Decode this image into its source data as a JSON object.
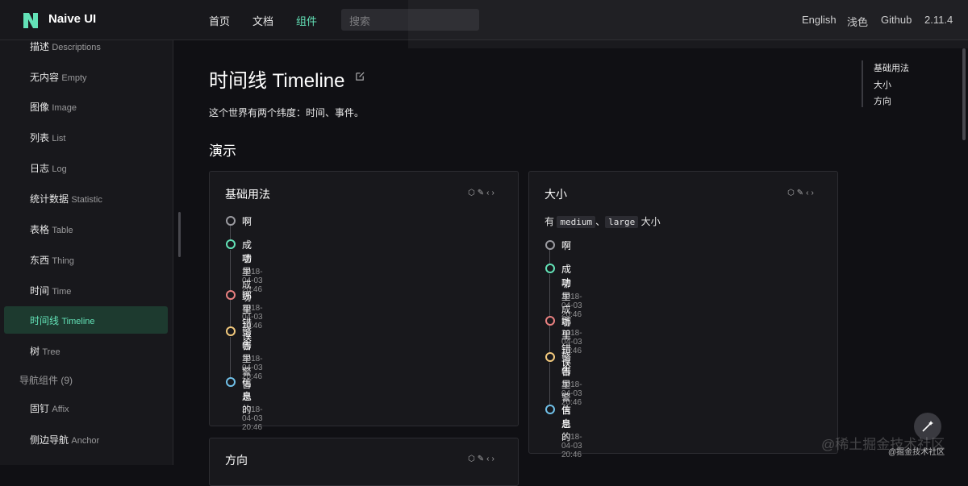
{
  "header": {
    "logo_text": "Naive UI",
    "nav": [
      "首页",
      "文档",
      "组件"
    ],
    "active_nav": "组件",
    "search_placeholder": "搜索",
    "right": [
      "English",
      "浅色",
      "Github",
      "2.11.4"
    ]
  },
  "sidebar": {
    "items": [
      {
        "zh": "描述",
        "en": "Descriptions"
      },
      {
        "zh": "无内容",
        "en": "Empty"
      },
      {
        "zh": "图像",
        "en": "Image"
      },
      {
        "zh": "列表",
        "en": "List"
      },
      {
        "zh": "日志",
        "en": "Log"
      },
      {
        "zh": "统计数据",
        "en": "Statistic"
      },
      {
        "zh": "表格",
        "en": "Table"
      },
      {
        "zh": "东西",
        "en": "Thing"
      },
      {
        "zh": "时间",
        "en": "Time"
      },
      {
        "zh": "时间线",
        "en": "Timeline"
      },
      {
        "zh": "树",
        "en": "Tree"
      }
    ],
    "group": "导航组件 (9)",
    "group_items": [
      {
        "zh": "固钉",
        "en": "Affix"
      },
      {
        "zh": "侧边导航",
        "en": "Anchor"
      }
    ]
  },
  "page": {
    "title": "时间线 Timeline",
    "description": "这个世界有两个纬度：时间、事件。",
    "section": "演示"
  },
  "cards": {
    "basic": {
      "title": "基础用法"
    },
    "size": {
      "title": "大小",
      "desc_prefix": "有",
      "code1": "medium",
      "sep": "、",
      "code2": "large",
      "desc_suffix": "大小"
    },
    "direction": {
      "title": "方向"
    }
  },
  "timeline_items": [
    {
      "title": "啊",
      "content": "",
      "time": "",
      "color": "#9a9aa0"
    },
    {
      "title": "成功",
      "content": "哪里成功",
      "time": "2018-04-03 20:46",
      "color": "#63e2b7"
    },
    {
      "title": "哪里错误",
      "content": "",
      "time": "2018-04-03 20:46",
      "color": "#e88080"
    },
    {
      "title": "警告",
      "content": "哪里警告",
      "time": "2018-04-03 20:46",
      "color": "#f2c97d"
    },
    {
      "title": "信息",
      "content": "是的",
      "time": "2018-04-03 20:46",
      "color": "#70c0e8"
    }
  ],
  "anchor": [
    "基础用法",
    "大小",
    "方向"
  ],
  "watermark": "@稀土掘金技术社区",
  "watermark_small": "@掘金技术社区",
  "colors": {
    "accent": "#63e2b7",
    "error": "#e88080",
    "warning": "#f2c97d",
    "info": "#70c0e8"
  }
}
